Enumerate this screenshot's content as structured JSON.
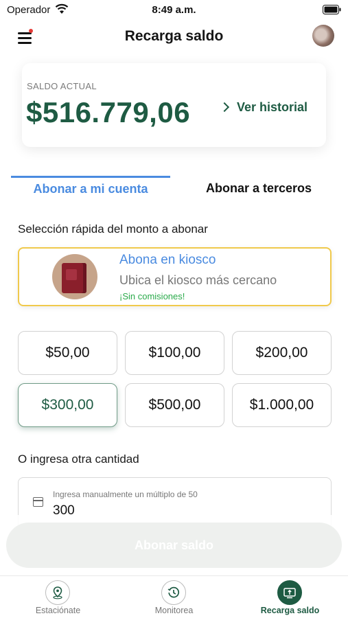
{
  "status_bar": {
    "carrier": "Operador",
    "time": "8:49 a.m."
  },
  "header": {
    "title": "Recarga saldo"
  },
  "balance": {
    "label": "SALDO ACTUAL",
    "amount": "$516.779,06",
    "history_link": "Ver historial"
  },
  "tabs": [
    {
      "label": "Abonar a mi cuenta",
      "active": true
    },
    {
      "label": "Abonar a terceros",
      "active": false
    }
  ],
  "quick_select": {
    "label": "Selección rápida del monto a abonar"
  },
  "kiosk": {
    "title": "Abona en kiosco",
    "subtitle": "Ubica el kiosco más cercano",
    "note": "¡Sin comisiones!"
  },
  "amounts": [
    "$50,00",
    "$100,00",
    "$200,00",
    "$300,00",
    "$500,00",
    "$1.000,00"
  ],
  "selected_amount": "$300,00",
  "other_amount": {
    "label": "O ingresa otra cantidad",
    "field_label": "Ingresa manualmente un múltiplo de 50",
    "value": "300"
  },
  "submit_label": "Abonar saldo",
  "bottom_nav": [
    {
      "label": "Estaciónate",
      "icon": "location-pin-icon",
      "active": false
    },
    {
      "label": "Monitorea",
      "icon": "clock-history-icon",
      "active": false
    },
    {
      "label": "Recarga saldo",
      "icon": "recharge-icon",
      "active": true
    }
  ],
  "colors": {
    "brand_green": "#1e5b43",
    "tab_blue": "#4a8be0",
    "kiosk_border": "#f0c94b",
    "note_green": "#2aaa4a"
  }
}
